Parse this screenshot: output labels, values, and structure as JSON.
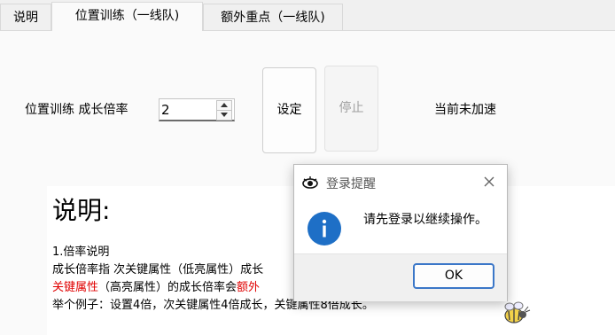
{
  "tabs": [
    {
      "label": "说明"
    },
    {
      "label": "位置训练（一线队)"
    },
    {
      "label": "额外重点（一线队)"
    }
  ],
  "controls": {
    "rate_label": "位置训练 成长倍率",
    "rate_value": "2",
    "set_button": "设定",
    "stop_button": "停止",
    "status_text": "当前未加速"
  },
  "doc": {
    "title": "说明:",
    "line1": "1.倍率说明",
    "line2": "成长倍率指 次关键属性（低亮属性）成长",
    "line3_red": "关键属性",
    "line3_mid": "（高亮属性）的成长倍率会",
    "line3_red2": "额外",
    "line4": "举个例子：设置4倍，次关键属性4倍成长，关键属性8倍成长。"
  },
  "dialog": {
    "title": "登录提醒",
    "message": "请先登录以继续操作。",
    "ok_label": "OK"
  },
  "colors": {
    "accent": "#3b77c8",
    "info_blue": "#1e6fc6",
    "highlight_red": "#e00000"
  },
  "icons": {
    "close": "close-icon",
    "info": "info-icon",
    "app": "eye-app-icon",
    "mascot": "bee-mascot-icon"
  }
}
